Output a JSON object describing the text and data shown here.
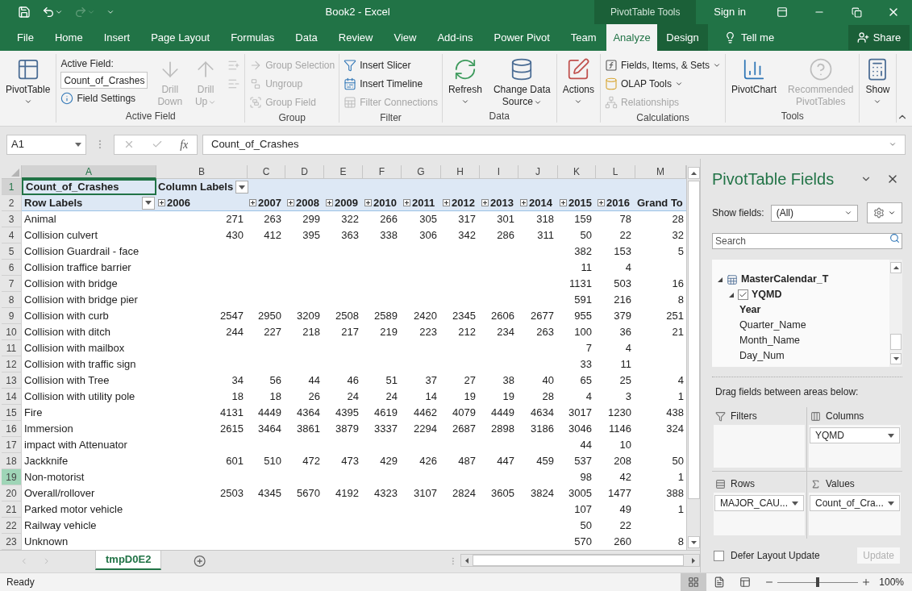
{
  "quick_access": {
    "redo_disabled": true
  },
  "title": "Book2 - Excel",
  "contextual_group": "PivotTable Tools",
  "sign_in": "Sign in",
  "tabs": [
    {
      "label": "File",
      "selected": false,
      "contextual": false
    },
    {
      "label": "Home",
      "selected": false,
      "contextual": false
    },
    {
      "label": "Insert",
      "selected": false,
      "contextual": false
    },
    {
      "label": "Page Layout",
      "selected": false,
      "contextual": false
    },
    {
      "label": "Formulas",
      "selected": false,
      "contextual": false
    },
    {
      "label": "Data",
      "selected": false,
      "contextual": false
    },
    {
      "label": "Review",
      "selected": false,
      "contextual": false
    },
    {
      "label": "View",
      "selected": false,
      "contextual": false
    },
    {
      "label": "Add-ins",
      "selected": false,
      "contextual": false
    },
    {
      "label": "Power Pivot",
      "selected": false,
      "contextual": false
    },
    {
      "label": "Team",
      "selected": false,
      "contextual": false
    },
    {
      "label": "Analyze",
      "selected": true,
      "contextual": true
    },
    {
      "label": "Design",
      "selected": false,
      "contextual": true
    }
  ],
  "tell_me": "Tell me",
  "share": "Share",
  "ribbon": {
    "groups": [
      {
        "columns": [
          {
            "kind": "large",
            "lines": [
              "PivotTable"
            ],
            "dropdown": true,
            "disabled": false
          }
        ]
      },
      {
        "label": "Active Field",
        "columns": [
          {
            "kind": "stack",
            "entries": [
              {
                "kind": "caption",
                "text": "Active Field:"
              },
              {
                "kind": "field",
                "value": "Count_of_Crashes"
              },
              {
                "kind": "button",
                "text": "Field Settings",
                "disabled": false,
                "dropdown": false
              }
            ]
          },
          {
            "kind": "large",
            "lines": [
              "Drill",
              "Down"
            ],
            "dropdown": false,
            "disabled": true
          },
          {
            "kind": "large",
            "lines": [
              "Drill",
              "Up"
            ],
            "dropdown": true,
            "disabled": true
          },
          {
            "kind": "stack",
            "entries": [
              {
                "kind": "icon",
                "disabled": true
              },
              {
                "kind": "icon",
                "disabled": true
              }
            ]
          }
        ]
      },
      {
        "label": "Group",
        "columns": [
          {
            "kind": "stack",
            "entries": [
              {
                "kind": "button",
                "text": "Group Selection",
                "disabled": true,
                "dropdown": false
              },
              {
                "kind": "button",
                "text": "Ungroup",
                "disabled": true,
                "dropdown": false
              },
              {
                "kind": "button",
                "text": "Group Field",
                "disabled": true,
                "dropdown": false
              }
            ]
          }
        ]
      },
      {
        "label": "Filter",
        "columns": [
          {
            "kind": "stack",
            "entries": [
              {
                "kind": "button",
                "text": "Insert Slicer",
                "disabled": false,
                "dropdown": false
              },
              {
                "kind": "button",
                "text": "Insert Timeline",
                "disabled": false,
                "dropdown": false
              },
              {
                "kind": "button",
                "text": "Filter Connections",
                "disabled": true,
                "dropdown": false
              }
            ]
          }
        ]
      },
      {
        "label": "Data",
        "columns": [
          {
            "kind": "large",
            "lines": [
              "Refresh"
            ],
            "dropdown": true,
            "disabled": false
          },
          {
            "kind": "large",
            "lines": [
              "Change Data",
              "Source"
            ],
            "dropdown": true,
            "disabled": false
          }
        ]
      },
      {
        "columns": [
          {
            "kind": "large",
            "lines": [
              "Actions"
            ],
            "dropdown": true,
            "disabled": false
          }
        ]
      },
      {
        "label": "Calculations",
        "columns": [
          {
            "kind": "stack",
            "entries": [
              {
                "kind": "button",
                "text": "Fields, Items, & Sets",
                "disabled": false,
                "dropdown": true
              },
              {
                "kind": "button",
                "text": "OLAP Tools",
                "disabled": false,
                "dropdown": true
              },
              {
                "kind": "button",
                "text": "Relationships",
                "disabled": true,
                "dropdown": false
              }
            ]
          }
        ]
      },
      {
        "label": "Tools",
        "columns": [
          {
            "kind": "large",
            "lines": [
              "PivotChart"
            ],
            "dropdown": false,
            "disabled": false
          },
          {
            "kind": "large",
            "lines": [
              "Recommended",
              "PivotTables"
            ],
            "dropdown": false,
            "disabled": true
          }
        ]
      },
      {
        "columns": [
          {
            "kind": "large",
            "lines": [
              "Show"
            ],
            "dropdown": true,
            "disabled": false
          }
        ]
      }
    ]
  },
  "formula_bar": {
    "name_box": "A1",
    "function_label": "fx",
    "formula": "Count_of_Crashes"
  },
  "sheet": {
    "columns": [
      {
        "letter": "A",
        "selected": true
      },
      {
        "letter": "B",
        "selected": false
      },
      {
        "letter": "C",
        "selected": false
      },
      {
        "letter": "D",
        "selected": false
      },
      {
        "letter": "E",
        "selected": false
      },
      {
        "letter": "F",
        "selected": false
      },
      {
        "letter": "G",
        "selected": false
      },
      {
        "letter": "H",
        "selected": false
      },
      {
        "letter": "I",
        "selected": false
      },
      {
        "letter": "J",
        "selected": false
      },
      {
        "letter": "K",
        "selected": false
      },
      {
        "letter": "L",
        "selected": false
      },
      {
        "letter": "M",
        "selected": false
      }
    ],
    "rows": [
      {
        "kind": "title",
        "number": "1",
        "active": true,
        "hovered": false,
        "label": "Count_of_Crashes",
        "column_labels": "Column Labels"
      },
      {
        "kind": "header",
        "number": "2",
        "active": false,
        "hovered": false,
        "label": "Row Labels",
        "years": [
          "2006",
          "2007",
          "2008",
          "2009",
          "2010",
          "2011",
          "2012",
          "2013",
          "2014",
          "2015",
          "2016"
        ],
        "grand_total": "Grand To"
      },
      {
        "kind": "data",
        "number": "3",
        "active": false,
        "hovered": false,
        "label": "Animal",
        "values": [
          "271",
          "263",
          "299",
          "322",
          "266",
          "305",
          "317",
          "301",
          "318",
          "159",
          "78"
        ],
        "grand_total": "28"
      },
      {
        "kind": "data",
        "number": "4",
        "active": false,
        "hovered": false,
        "label": "Collision culvert",
        "values": [
          "430",
          "412",
          "395",
          "363",
          "338",
          "306",
          "342",
          "286",
          "311",
          "50",
          "22"
        ],
        "grand_total": "32"
      },
      {
        "kind": "data",
        "number": "5",
        "active": false,
        "hovered": false,
        "label": "Collision Guardrail - face",
        "values": [
          "382",
          "153"
        ],
        "grand_total": "5"
      },
      {
        "kind": "data",
        "number": "6",
        "active": false,
        "hovered": false,
        "label": "Collision traffice barrier",
        "values": [
          "11",
          "4"
        ]
      },
      {
        "kind": "data",
        "number": "7",
        "active": false,
        "hovered": false,
        "label": "Collision with bridge",
        "values": [
          "1131",
          "503"
        ],
        "grand_total": "16"
      },
      {
        "kind": "data",
        "number": "8",
        "active": false,
        "hovered": false,
        "label": "Collision with bridge pier",
        "values": [
          "591",
          "216"
        ],
        "grand_total": "8"
      },
      {
        "kind": "data",
        "number": "9",
        "active": false,
        "hovered": false,
        "label": "Collision with curb",
        "values": [
          "2547",
          "2950",
          "3209",
          "2508",
          "2589",
          "2420",
          "2345",
          "2606",
          "2677",
          "955",
          "379"
        ],
        "grand_total": "251"
      },
      {
        "kind": "data",
        "number": "10",
        "active": false,
        "hovered": false,
        "label": "Collision with ditch",
        "values": [
          "244",
          "227",
          "218",
          "217",
          "219",
          "223",
          "212",
          "234",
          "263",
          "100",
          "36"
        ],
        "grand_total": "21"
      },
      {
        "kind": "data",
        "number": "11",
        "active": false,
        "hovered": false,
        "label": "Collision with mailbox",
        "values": [
          "7",
          "4"
        ]
      },
      {
        "kind": "data",
        "number": "12",
        "active": false,
        "hovered": false,
        "label": "Collision with traffic sign",
        "values": [
          "33",
          "11"
        ]
      },
      {
        "kind": "data",
        "number": "13",
        "active": false,
        "hovered": false,
        "label": "Collision with Tree",
        "values": [
          "34",
          "56",
          "44",
          "46",
          "51",
          "37",
          "27",
          "38",
          "40",
          "65",
          "25"
        ],
        "grand_total": "4"
      },
      {
        "kind": "data",
        "number": "14",
        "active": false,
        "hovered": false,
        "label": "Collision with utility pole",
        "values": [
          "18",
          "18",
          "26",
          "24",
          "24",
          "14",
          "19",
          "19",
          "28",
          "4",
          "3"
        ],
        "grand_total": "1"
      },
      {
        "kind": "data",
        "number": "15",
        "active": false,
        "hovered": false,
        "label": "Fire",
        "values": [
          "4131",
          "4449",
          "4364",
          "4395",
          "4619",
          "4462",
          "4079",
          "4449",
          "4634",
          "3017",
          "1230"
        ],
        "grand_total": "438"
      },
      {
        "kind": "data",
        "number": "16",
        "active": false,
        "hovered": false,
        "label": "Immersion",
        "values": [
          "2615",
          "3464",
          "3861",
          "3879",
          "3337",
          "2294",
          "2687",
          "2898",
          "3186",
          "3046",
          "1146"
        ],
        "grand_total": "324"
      },
      {
        "kind": "data",
        "number": "17",
        "active": false,
        "hovered": false,
        "label": "impact with Attenuator",
        "values": [
          "44",
          "10"
        ]
      },
      {
        "kind": "data",
        "number": "18",
        "active": false,
        "hovered": false,
        "label": "Jackknife",
        "values": [
          "601",
          "510",
          "472",
          "473",
          "429",
          "426",
          "487",
          "447",
          "459",
          "537",
          "208"
        ],
        "grand_total": "50"
      },
      {
        "kind": "data",
        "number": "19",
        "active": false,
        "hovered": true,
        "label": "Non-motorist",
        "values": [
          "98",
          "42"
        ],
        "grand_total": "1"
      },
      {
        "kind": "data",
        "number": "20",
        "active": false,
        "hovered": false,
        "label": "Overall/rollover",
        "values": [
          "2503",
          "4345",
          "5670",
          "4192",
          "4323",
          "3107",
          "2824",
          "3605",
          "3824",
          "3005",
          "1477"
        ],
        "grand_total": "388"
      },
      {
        "kind": "data",
        "number": "21",
        "active": false,
        "hovered": false,
        "label": "Parked motor vehicle",
        "values": [
          "107",
          "49"
        ],
        "grand_total": "1"
      },
      {
        "kind": "data",
        "number": "22",
        "active": false,
        "hovered": false,
        "label": "Railway vehicle",
        "values": [
          "50",
          "22"
        ]
      },
      {
        "kind": "data",
        "number": "23",
        "active": false,
        "hovered": false,
        "label": "Unknown",
        "values": [
          "570",
          "260"
        ],
        "grand_total": "8"
      }
    ]
  },
  "sheet_tabs": [
    {
      "label": "tmpD0E2",
      "selected": true
    }
  ],
  "pivot_fields": {
    "title": "PivotTable Fields",
    "show_fields_label": "Show fields:",
    "show_fields_value": "(All)",
    "search_placeholder": "Search",
    "tree": [
      {
        "kind": "table",
        "label": "MasterCalendar_T",
        "expanded": true,
        "children": [
          {
            "kind": "hierarchy",
            "label": "YQMD",
            "checked": true,
            "expanded": true,
            "children": [
              {
                "kind": "level",
                "label": "Year",
                "in_use": true
              },
              {
                "kind": "level",
                "label": "Quarter_Name",
                "in_use": false
              },
              {
                "kind": "level",
                "label": "Month_Name",
                "in_use": false
              },
              {
                "kind": "level",
                "label": "Day_Num",
                "in_use": false
              }
            ]
          }
        ]
      }
    ],
    "drag_hint": "Drag fields between areas below:",
    "areas": [
      {
        "kind": "filters",
        "label": "Filters"
      },
      {
        "kind": "columns",
        "label": "Columns",
        "fields": [
          "YQMD"
        ]
      },
      {
        "kind": "rows",
        "label": "Rows",
        "fields": [
          "MAJOR_CAU..."
        ]
      },
      {
        "kind": "values",
        "label": "Values",
        "fields": [
          "Count_of_Cra..."
        ]
      }
    ],
    "defer_label": "Defer Layout Update",
    "defer_checked": false,
    "update_button": "Update",
    "update_disabled": true
  },
  "status_bar": {
    "status": "Ready",
    "views": [
      {
        "selected": true
      },
      {
        "selected": false
      },
      {
        "selected": false
      }
    ],
    "zoom_slider": {
      "level": 0.5
    },
    "zoom_text": "100%"
  }
}
